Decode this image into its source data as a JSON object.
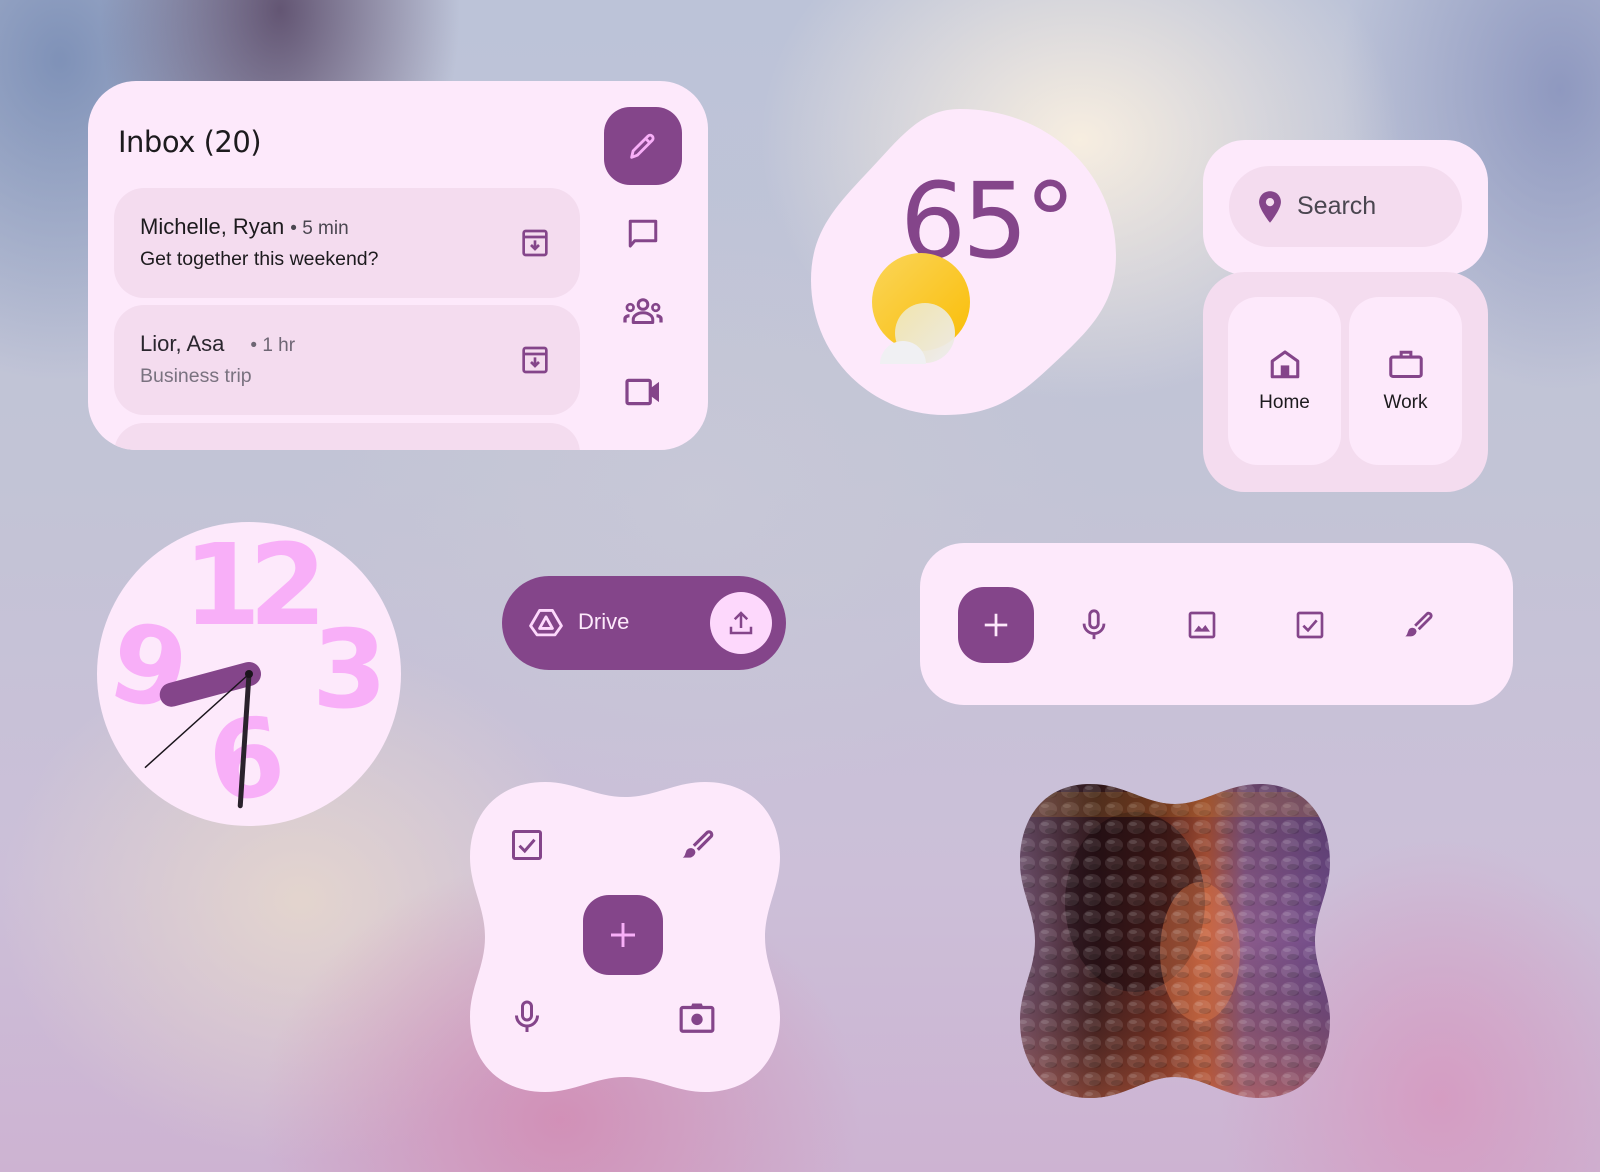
{
  "colors": {
    "primary": "#84458a",
    "surface": "#fde9fb",
    "surface_variant": "#f4dcef",
    "clock_numerals": "#f8aff8",
    "sun": "#f9bd05"
  },
  "inbox": {
    "title": "Inbox (20)",
    "compose_icon": "pencil-icon",
    "rail_icons": [
      "chat-bubble-icon",
      "group-icon",
      "videocam-icon"
    ],
    "messages": [
      {
        "sender": "Michelle, Ryan",
        "time": "• 5 min",
        "subject": "Get together this weekend?",
        "unread": true,
        "action_icon": "archive-icon"
      },
      {
        "sender": "Lior, Asa",
        "time": "• 1 hr",
        "subject": "Business trip",
        "unread": false,
        "action_icon": "archive-icon"
      }
    ]
  },
  "weather": {
    "temperature": "65°",
    "condition_icon": "partly-sunny-icon"
  },
  "maps": {
    "search_placeholder": "Search",
    "search_icon": "location-pin-icon",
    "shortcuts": [
      {
        "label": "Home",
        "icon": "home-icon"
      },
      {
        "label": "Work",
        "icon": "briefcase-icon"
      }
    ]
  },
  "clock": {
    "numerals": [
      "12",
      "3",
      "6",
      "9"
    ],
    "time": {
      "hour": 8,
      "minute": 30,
      "second": 38
    }
  },
  "drive": {
    "label": "Drive",
    "icon": "drive-icon",
    "action_icon": "upload-icon"
  },
  "note_toolbar": {
    "add_icon": "plus-icon",
    "tools": [
      "mic-icon",
      "image-icon",
      "checkbox-icon",
      "brush-icon"
    ]
  },
  "quick_actions": {
    "center_icon": "plus-icon",
    "corners": [
      "checkbox-icon",
      "brush-icon",
      "mic-icon",
      "camera-icon"
    ]
  },
  "photo": {
    "description": "Hammered glass texture photo in copper and purple tones"
  }
}
